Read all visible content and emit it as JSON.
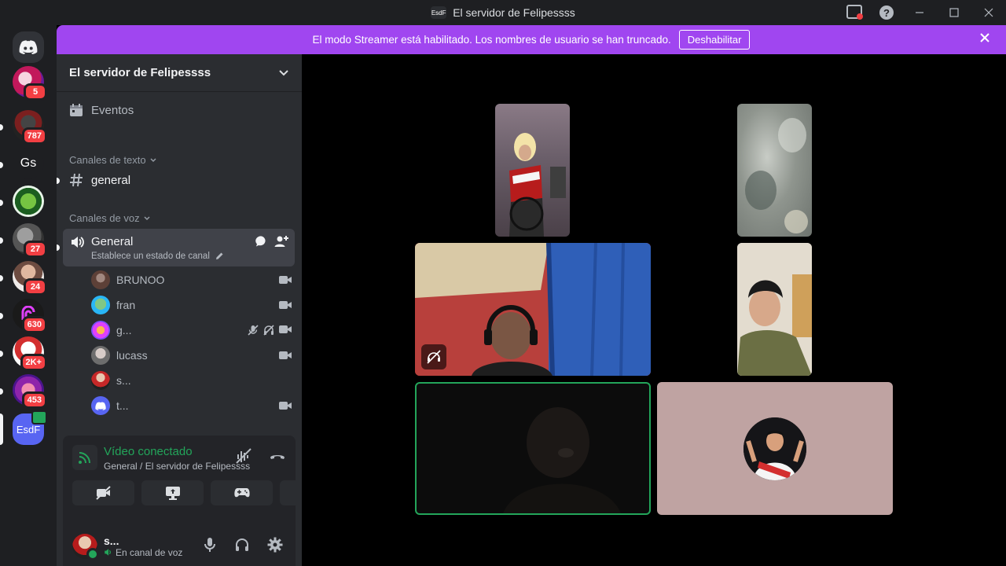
{
  "window": {
    "title": "El servidor de Felipessss",
    "server_abbr": "EsdF"
  },
  "banner": {
    "message": "El modo Streamer está habilitado. Los nombres de usuario se han truncado.",
    "button_label": "Deshabilitar",
    "color": "#a046f0"
  },
  "guilds": [
    {
      "icon": "discord-home-icon",
      "label": "",
      "badge": ""
    },
    {
      "icon": "server-icon",
      "label": "",
      "badge": "5"
    },
    {
      "icon": "server-icon",
      "label": "",
      "badge": "787"
    },
    {
      "icon": "server-icon",
      "label": "Gs",
      "badge": ""
    },
    {
      "icon": "server-icon",
      "label": "",
      "badge": ""
    },
    {
      "icon": "server-icon",
      "label": "",
      "badge": "27"
    },
    {
      "icon": "server-icon",
      "label": "",
      "badge": "24"
    },
    {
      "icon": "server-icon",
      "label": "",
      "badge": "630"
    },
    {
      "icon": "server-icon",
      "label": "",
      "badge": "2K+"
    },
    {
      "icon": "server-icon",
      "label": "",
      "badge": "453"
    },
    {
      "icon": "server-icon",
      "label": "EsdF",
      "badge": ""
    }
  ],
  "sidebar": {
    "server_name": "El servidor de Felipessss",
    "events_label": "Eventos",
    "text_category": "Canales de texto",
    "text_channel": "general",
    "voice_category": "Canales de voz",
    "voice_channel": {
      "name": "General",
      "status_placeholder": "Establece un estado de canal"
    },
    "members": [
      {
        "name": "BRUNOO",
        "camera": true,
        "muted": false,
        "deafened": false
      },
      {
        "name": "fran",
        "camera": true,
        "muted": false,
        "deafened": false
      },
      {
        "name": "g...",
        "camera": true,
        "muted": true,
        "deafened": true
      },
      {
        "name": "lucass",
        "camera": true,
        "muted": false,
        "deafened": false
      },
      {
        "name": "s...",
        "camera": false,
        "muted": false,
        "deafened": false
      },
      {
        "name": "t...",
        "camera": true,
        "muted": false,
        "deafened": false
      }
    ]
  },
  "voice_panel": {
    "status": "Vídeo conectado",
    "location": "General / El servidor de Felipessss"
  },
  "user": {
    "name": "s...",
    "status": "En canal de voz"
  },
  "colors": {
    "connected_green": "#23a55a",
    "sidebar_bg": "#2b2d31",
    "guild_bg": "#1e1f22",
    "selected_channel": "#404249"
  }
}
